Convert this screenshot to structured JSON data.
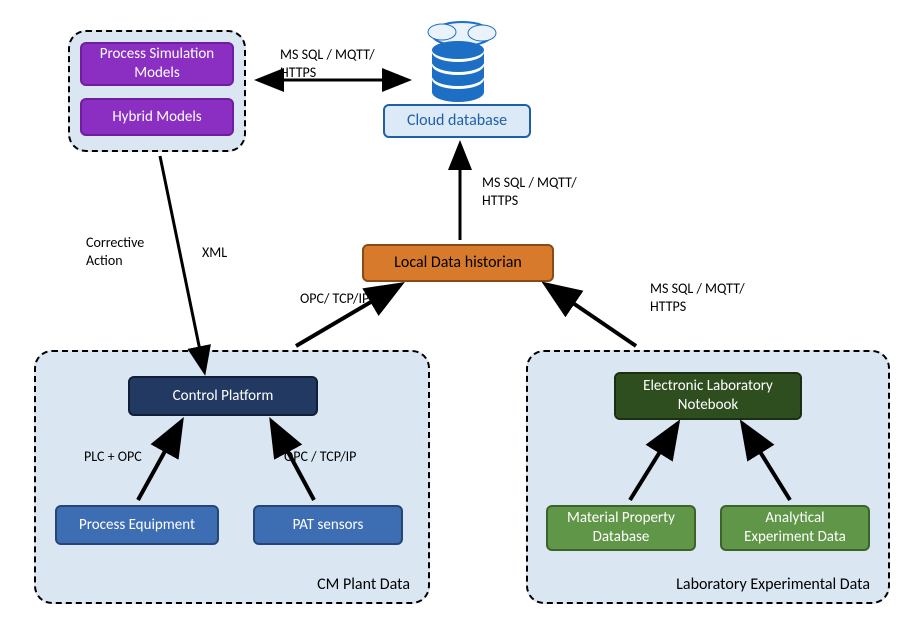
{
  "diagram": {
    "nodes": {
      "cloud_db": "Cloud database",
      "local_historian": "Local Data historian",
      "models_sim": "Process Simulation Models",
      "models_hybrid": "Hybrid Models",
      "control_platform": "Control Platform",
      "process_equipment": "Process Equipment",
      "pat_sensors": "PAT sensors",
      "eln": "Electronic Laboratory Notebook",
      "material_db": "Material Property Database",
      "analytical_data": "Analytical Experiment Data"
    },
    "groups": {
      "cm_plant": "CM Plant Data",
      "lab_data": "Laboratory Experimental Data"
    },
    "edges": {
      "models_to_cloud": "MS SQL / MQTT/ HTTPS",
      "historian_to_cloud": "MS SQL / MQTT/ HTTPS",
      "lab_to_historian": "MS SQL / MQTT/ HTTPS",
      "cm_to_historian": "OPC/ TCP/IP",
      "models_to_cm_corrective": "Corrective Action",
      "models_to_cm_xml": "XML",
      "equip_to_ctrl": "PLC + OPC",
      "pat_to_ctrl": "OPC / TCP/IP"
    },
    "colors": {
      "cloud_db_fill": "#dbeaf6",
      "cloud_db_border": "#1f5fa9",
      "historian_fill": "#d87a2b",
      "historian_border": "#8a4a16",
      "models_fill": "#8a2fc1",
      "models_border": "#6f1ea1",
      "control_fill": "#223a62",
      "control_border": "#0f1f37",
      "cm_sub_fill": "#3d6db3",
      "cm_sub_border": "#254775",
      "eln_fill": "#2f4e1f",
      "eln_border": "#1a2e10",
      "lab_sub_fill": "#5f9647",
      "lab_sub_border": "#3c6329",
      "group_fill": "#dae7f3",
      "icon_blue": "#1c6fc4"
    }
  }
}
